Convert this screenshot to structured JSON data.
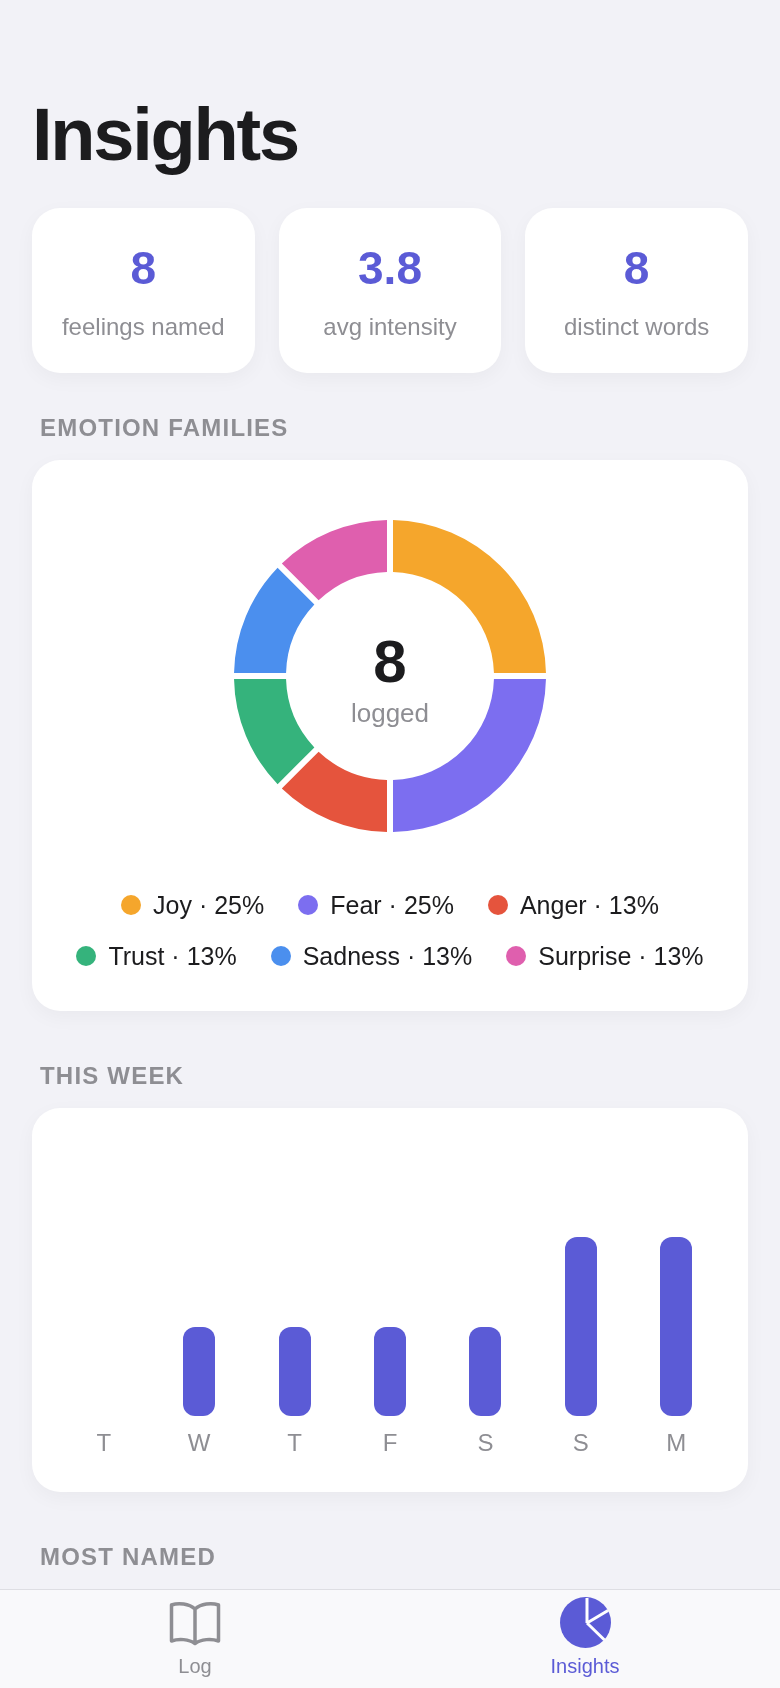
{
  "title": "Insights",
  "stats": [
    {
      "value": "8",
      "label": "feelings named"
    },
    {
      "value": "3.8",
      "label": "avg intensity"
    },
    {
      "value": "8",
      "label": "distinct words"
    }
  ],
  "emotion_families": {
    "title": "EMOTION FAMILIES",
    "center_value": "8",
    "center_label": "logged",
    "chart_data": {
      "type": "donut",
      "values": [
        25,
        25,
        12.5,
        12.5,
        12.5,
        12.5
      ]
    },
    "legend": [
      {
        "label": "Joy · 25%",
        "color": "#f5a62c"
      },
      {
        "label": "Fear · 25%",
        "color": "#7c6ef0"
      },
      {
        "label": "Anger · 13%",
        "color": "#e5543d"
      },
      {
        "label": "Trust · 13%",
        "color": "#35b37c"
      },
      {
        "label": "Sadness · 13%",
        "color": "#4b8fee"
      },
      {
        "label": "Surprise · 13%",
        "color": "#df5fae"
      }
    ]
  },
  "this_week": {
    "title": "THIS WEEK",
    "days": [
      "T",
      "W",
      "T",
      "F",
      "S",
      "S",
      "M"
    ]
  },
  "most_named": {
    "title": "MOST NAMED"
  },
  "tab_bar": {
    "items": [
      {
        "label": "Log",
        "selected": false
      },
      {
        "label": "Insights",
        "selected": true
      }
    ]
  }
}
